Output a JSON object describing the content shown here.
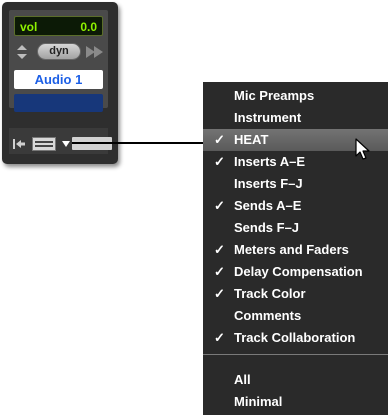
{
  "strip": {
    "vol_label": "vol",
    "vol_value": "0.0",
    "automation_mode": "dyn",
    "track_name": "Audio 1"
  },
  "menu": {
    "items": [
      {
        "label": "Mic Preamps",
        "checked": false,
        "highlighted": false
      },
      {
        "label": "Instrument",
        "checked": false,
        "highlighted": false
      },
      {
        "label": "HEAT",
        "checked": true,
        "highlighted": true
      },
      {
        "label": "Inserts A–E",
        "checked": true,
        "highlighted": false
      },
      {
        "label": "Inserts F–J",
        "checked": false,
        "highlighted": false
      },
      {
        "label": "Sends A–E",
        "checked": true,
        "highlighted": false
      },
      {
        "label": "Sends F–J",
        "checked": false,
        "highlighted": false
      },
      {
        "label": "Meters and Faders",
        "checked": true,
        "highlighted": false
      },
      {
        "label": "Delay Compensation",
        "checked": true,
        "highlighted": false
      },
      {
        "label": "Track Color",
        "checked": true,
        "highlighted": false
      },
      {
        "label": "Comments",
        "checked": false,
        "highlighted": false
      },
      {
        "label": "Track Collaboration",
        "checked": true,
        "highlighted": false
      }
    ],
    "footer_items": [
      {
        "label": "All"
      },
      {
        "label": "Minimal"
      }
    ],
    "check_glyph": "✓"
  },
  "colors": {
    "strip_bg": "#2e2e2e",
    "display_text": "#8ef200",
    "track_name_text": "#1c5fe6",
    "track_color": "#17377a",
    "menu_bg": "#2a2a2a",
    "menu_highlight": "#6a6a6a"
  }
}
